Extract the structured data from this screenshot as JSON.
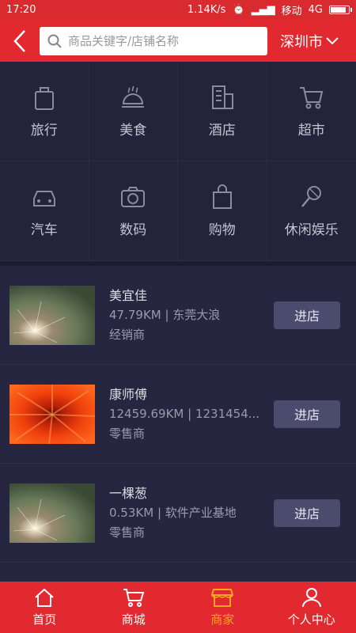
{
  "status": {
    "time": "17:20",
    "speed": "1.14K/s",
    "carrier": "移动",
    "network": "4G"
  },
  "header": {
    "search_placeholder": "商品关键字/店铺名称",
    "city": "深圳市"
  },
  "categories": [
    {
      "label": "旅行",
      "icon": "luggage-icon"
    },
    {
      "label": "美食",
      "icon": "food-cloche-icon"
    },
    {
      "label": "酒店",
      "icon": "building-icon"
    },
    {
      "label": "超市",
      "icon": "cart-icon"
    },
    {
      "label": "汽车",
      "icon": "car-icon"
    },
    {
      "label": "数码",
      "icon": "camera-icon"
    },
    {
      "label": "购物",
      "icon": "shopping-bag-icon"
    },
    {
      "label": "休闲娱乐",
      "icon": "microphone-icon"
    }
  ],
  "shops": [
    {
      "name": "美宜佳",
      "meta": "47.79KM | 东莞大浪",
      "type": "经销商",
      "button": "进店"
    },
    {
      "name": "康师傅",
      "meta": "12459.69KM | 1231454...",
      "type": "零售商",
      "button": "进店"
    },
    {
      "name": "一棵葱",
      "meta": "0.53KM | 软件产业基地",
      "type": "零售商",
      "button": "进店"
    }
  ],
  "tabs": [
    {
      "label": "首页",
      "icon": "home-icon"
    },
    {
      "label": "商城",
      "icon": "cart-icon"
    },
    {
      "label": "商家",
      "icon": "shop-icon",
      "active": true
    },
    {
      "label": "个人中心",
      "icon": "user-icon"
    }
  ],
  "colors": {
    "header_red": "#e2292f",
    "active_tab": "#f5a623",
    "background": "#23233a"
  }
}
